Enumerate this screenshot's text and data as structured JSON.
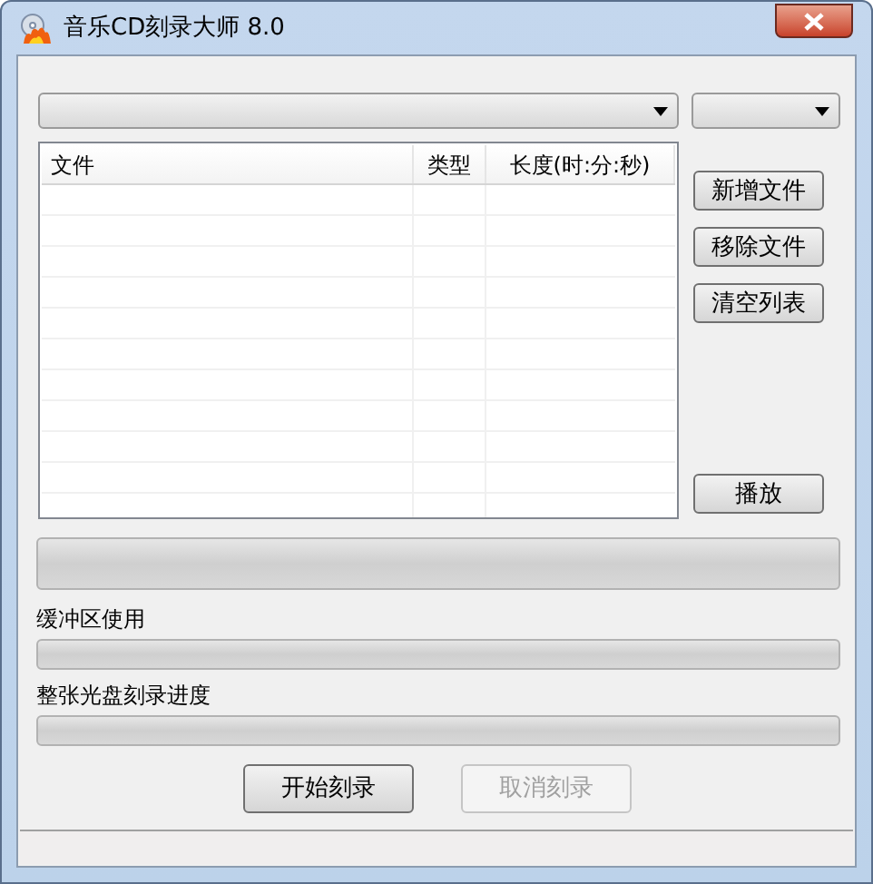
{
  "window": {
    "title": "音乐CD刻录大师 8.0"
  },
  "table": {
    "columns": [
      "文件",
      "类型",
      "长度(时:分:秒)"
    ]
  },
  "side_buttons": [
    {
      "label": "新增文件",
      "disabled": false
    },
    {
      "label": "移除文件",
      "disabled": false
    },
    {
      "label": "清空列表",
      "disabled": false
    },
    {
      "label": "播放",
      "disabled": false
    }
  ],
  "main_progress": {
    "level": 0
  },
  "buffer": {
    "label": "缓冲区使用",
    "level": 0
  },
  "disc_progress": {
    "label": "整张光盘刻录进度",
    "level": 0
  },
  "bottom_buttons": [
    {
      "label": "开始刻录",
      "disabled": false
    },
    {
      "label": "取消刻录",
      "disabled": true
    }
  ]
}
